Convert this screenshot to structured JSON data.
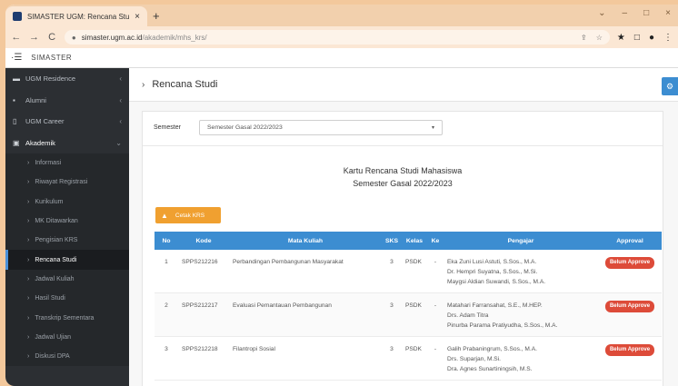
{
  "browser": {
    "tab_title": "SIMASTER UGM: Rencana Studi",
    "tab_close": "×",
    "new_tab": "+",
    "window_controls": [
      "⌄",
      "–",
      "□",
      "×"
    ],
    "url_host": "simaster.ugm.ac.id",
    "url_path": "/akademik/mhs_krs/",
    "extension_icons": [
      "★",
      "□",
      "●",
      "⋮"
    ]
  },
  "app": {
    "brand": "SIMASTER"
  },
  "sidebar": {
    "items": [
      {
        "label": "UGM Residence",
        "icon": "bed-icon"
      },
      {
        "label": "Alumni",
        "icon": "alumni-icon"
      },
      {
        "label": "UGM Career",
        "icon": "career-icon"
      },
      {
        "label": "Akademik",
        "icon": "book-icon"
      }
    ],
    "sub_items": [
      {
        "label": "Informasi"
      },
      {
        "label": "Riwayat Registrasi"
      },
      {
        "label": "Kurikulum"
      },
      {
        "label": "MK Ditawarkan"
      },
      {
        "label": "Pengisian KRS"
      },
      {
        "label": "Rencana Studi",
        "active": true
      },
      {
        "label": "Jadwal Kuliah"
      },
      {
        "label": "Hasil Studi"
      },
      {
        "label": "Transkrip Sementara"
      },
      {
        "label": "Jadwal Ujian"
      },
      {
        "label": "Diskusi DPA"
      }
    ]
  },
  "page": {
    "title": "Rencana Studi",
    "semester_label": "Semester",
    "semester_value": "Semester Gasal 2022/2023",
    "krs_title_line1": "Kartu Rencana Studi Mahasiswa",
    "krs_title_line2": "Semester Gasal 2022/2023",
    "cetak_label": "Cetak KRS"
  },
  "table": {
    "headers": [
      "No",
      "Kode",
      "Mata Kuliah",
      "SKS",
      "Kelas",
      "Ke",
      "Pengajar",
      "Approval"
    ],
    "rows": [
      {
        "no": "1",
        "kode": "SPPS212216",
        "mk": "Perbandingan Pembangunan Masyarakat",
        "sks": "3",
        "kelas": "PSDK",
        "ke": "-",
        "pengajar": [
          "Eka Zuni Lusi Astuti, S.Sos., M.A.",
          "Dr. Hempri Suyatna, S.Sos., M.Si.",
          "Maygsi Aldian Suwandi, S.Sos., M.A."
        ],
        "approval": "Belum Approve"
      },
      {
        "no": "2",
        "kode": "SPPS212217",
        "mk": "Evaluasi Pemantauan Pembangunan",
        "sks": "3",
        "kelas": "PSDK",
        "ke": "-",
        "pengajar": [
          "Matahari Farransahat, S.E., M.HEP.",
          "Drs. Adam Titra",
          "Pinurba Parama Pratiyudha, S.Sos., M.A."
        ],
        "approval": "Belum Approve"
      },
      {
        "no": "3",
        "kode": "SPPS212218",
        "mk": "Filantropi Sosial",
        "sks": "3",
        "kelas": "PSDK",
        "ke": "-",
        "pengajar": [
          "Galih Prabaningrum, S.Sos., M.A.",
          "Drs. Suparjan, M.Si.",
          "Dra. Agnes Sunartiningsih, M.S."
        ],
        "approval": "Belum Approve"
      }
    ]
  }
}
